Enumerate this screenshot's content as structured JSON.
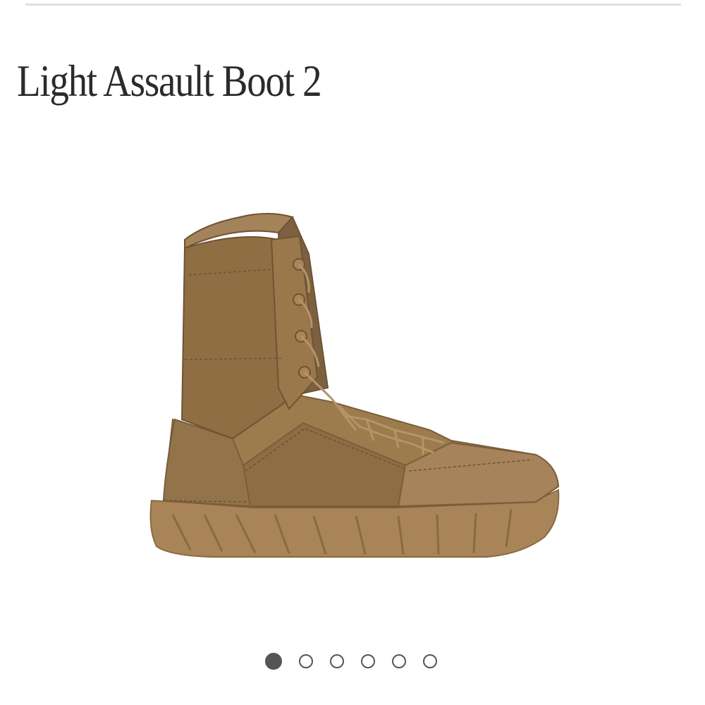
{
  "product": {
    "title": "Light Assault Boot 2"
  },
  "gallery": {
    "image_count": 6,
    "active_index": 0,
    "image_alt": "boot-side-view"
  },
  "colors": {
    "title_text": "#2b2b2b",
    "divider": "#e0e0e0",
    "dot": "#555555",
    "boot_main": "#9a7a4e",
    "boot_dark": "#7a5e3a",
    "boot_light": "#b08c5c",
    "sole": "#a88458"
  }
}
